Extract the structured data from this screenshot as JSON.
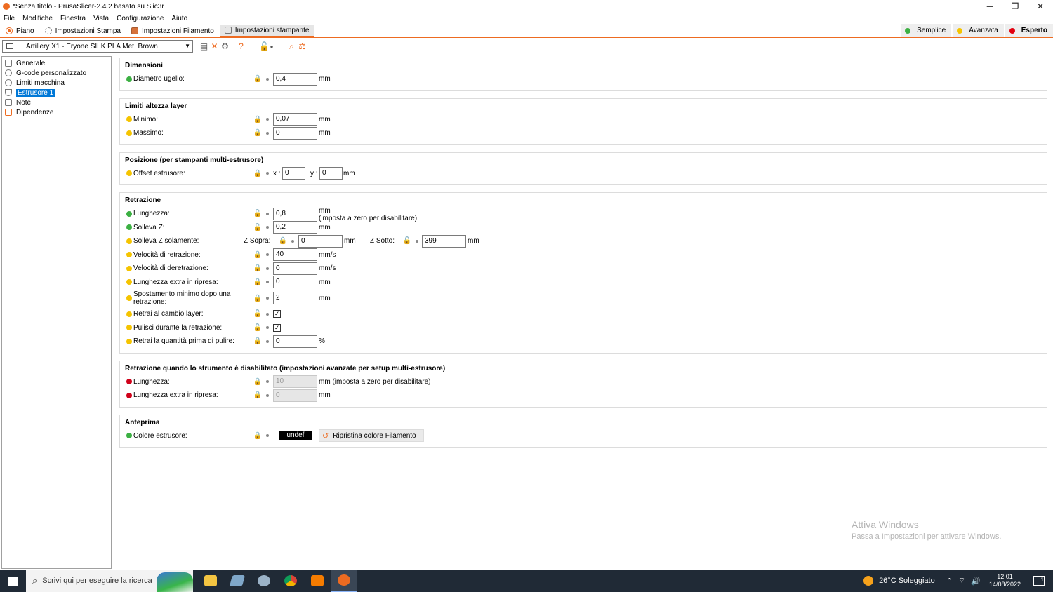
{
  "window": {
    "title": "*Senza titolo - PrusaSlicer-2.4.2 basato su Slic3r",
    "minimize": "─",
    "restore": "❐",
    "close": "✕"
  },
  "menu": [
    "File",
    "Modifiche",
    "Finestra",
    "Vista",
    "Configurazione",
    "Aiuto"
  ],
  "tabs": {
    "piano": "Piano",
    "stampa": "Impostazioni Stampa",
    "filamento": "Impostazioni Filamento",
    "stampante": "Impostazioni stampante"
  },
  "modes": {
    "simple": {
      "label": "Semplice",
      "color": "#3cb043"
    },
    "advanced": {
      "label": "Avanzata",
      "color": "#f5c400"
    },
    "expert": {
      "label": "Esperto",
      "color": "#e3000f"
    }
  },
  "preset": {
    "name": "Artillery X1 - Eryone SILK PLA Met. Brown"
  },
  "sidebar": [
    {
      "label": "Generale"
    },
    {
      "label": "G-code personalizzato"
    },
    {
      "label": "Limiti macchina"
    },
    {
      "label": "Estrusore 1"
    },
    {
      "label": "Note"
    },
    {
      "label": "Dipendenze"
    }
  ],
  "colors": {
    "green": "#3cb043",
    "yellow": "#f5c400",
    "red": "#d0021b",
    "accent": "#ed6b21"
  },
  "groups": {
    "dimensioni": {
      "title": "Dimensioni",
      "diametro": {
        "label": "Diametro ugello:",
        "value": "0,4",
        "unit": "mm"
      }
    },
    "limiti": {
      "title": "Limiti altezza layer",
      "minimo": {
        "label": "Minimo:",
        "value": "0,07",
        "unit": "mm"
      },
      "massimo": {
        "label": "Massimo:",
        "value": "0",
        "unit": "mm"
      }
    },
    "posizione": {
      "title": "Posizione (per stampanti multi-estrusore)",
      "offset": {
        "label": "Offset estrusore:",
        "x_label": "x :",
        "x_value": "0",
        "y_label": "y :",
        "y_value": "0",
        "unit": "mm"
      }
    },
    "retrazione": {
      "title": "Retrazione",
      "lunghezza": {
        "label": "Lunghezza:",
        "value": "0,8",
        "unit": "mm",
        "note": "(imposta a zero per disabilitare)"
      },
      "solleva_z": {
        "label": "Solleva Z:",
        "value": "0,2",
        "unit": "mm"
      },
      "solleva_solo": {
        "label": "Solleva Z solamente:",
        "sopra_label": "Z Sopra:",
        "sopra_value": "0",
        "sopra_unit": "mm",
        "sotto_label": "Z Sotto:",
        "sotto_value": "399",
        "sotto_unit": "mm"
      },
      "vel_retr": {
        "label": "Velocità di retrazione:",
        "value": "40",
        "unit": "mm/s"
      },
      "vel_deretr": {
        "label": "Velocità di deretrazione:",
        "value": "0",
        "unit": "mm/s"
      },
      "extra": {
        "label": "Lunghezza extra in ripresa:",
        "value": "0",
        "unit": "mm"
      },
      "spostamento": {
        "label": "Spostamento minimo dopo una retrazione:",
        "value": "2",
        "unit": "mm"
      },
      "cambio_layer": {
        "label": "Retrai al cambio layer:",
        "check": "✓"
      },
      "pulisci": {
        "label": "Pulisci durante la retrazione:",
        "check": "✓"
      },
      "quantita": {
        "label": "Retrai la quantità prima di pulire:",
        "value": "0",
        "unit": "%"
      }
    },
    "retrazione_dis": {
      "title": "Retrazione quando lo strumento è disabilitato (impostazioni avanzate per setup multi-estrusore)",
      "lunghezza": {
        "label": "Lunghezza:",
        "value": "10",
        "unit": "mm (imposta a zero per disabilitare)"
      },
      "extra": {
        "label": "Lunghezza extra in ripresa:",
        "value": "0",
        "unit": "mm"
      }
    },
    "anteprima": {
      "title": "Anteprima",
      "colore": {
        "label": "Colore estrusore:",
        "swatch": "undef",
        "reset": "Ripristina colore Filamento"
      }
    }
  },
  "watermark": {
    "line1": "Attiva Windows",
    "line2": "Passa a Impostazioni per attivare Windows."
  },
  "taskbar": {
    "search_placeholder": "Scrivi qui per eseguire la ricerca",
    "weather": "26°C Soleggiato",
    "time": "12:01",
    "date": "14/08/2022",
    "notifications": "1"
  }
}
